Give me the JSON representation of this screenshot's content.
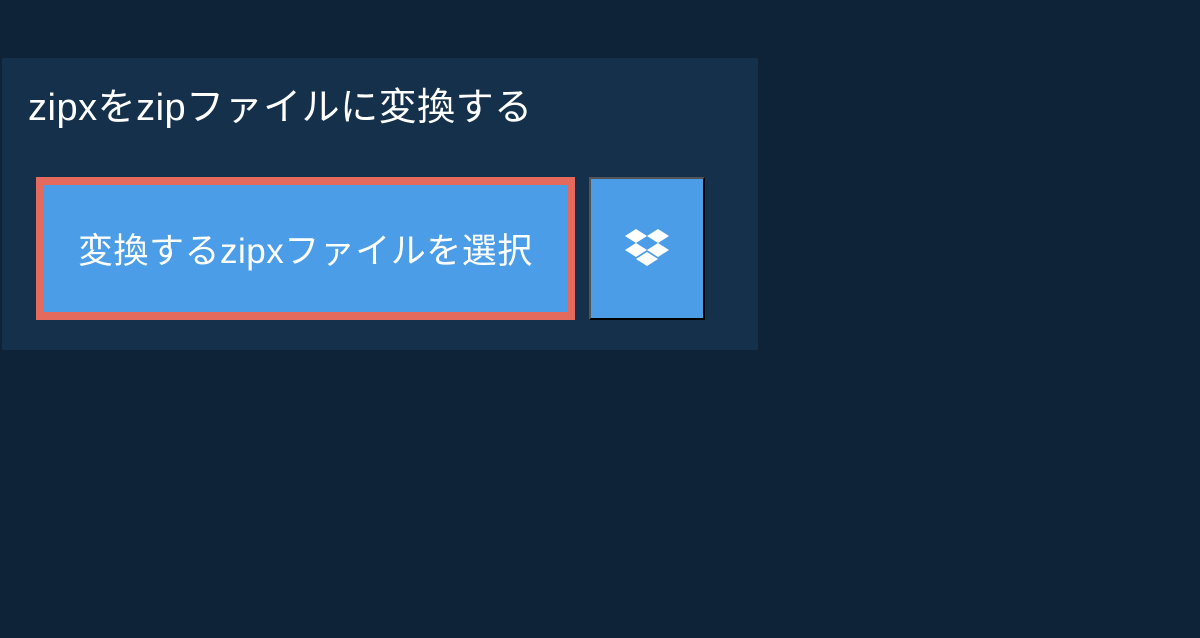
{
  "title": "zipxをzipファイルに変換する",
  "select_button_label": "変換するzipxファイルを選択",
  "colors": {
    "background": "#0e2338",
    "panel": "#15304b",
    "button": "#4b9de7",
    "highlight_border": "#e46a5e",
    "text": "#ffffff"
  }
}
